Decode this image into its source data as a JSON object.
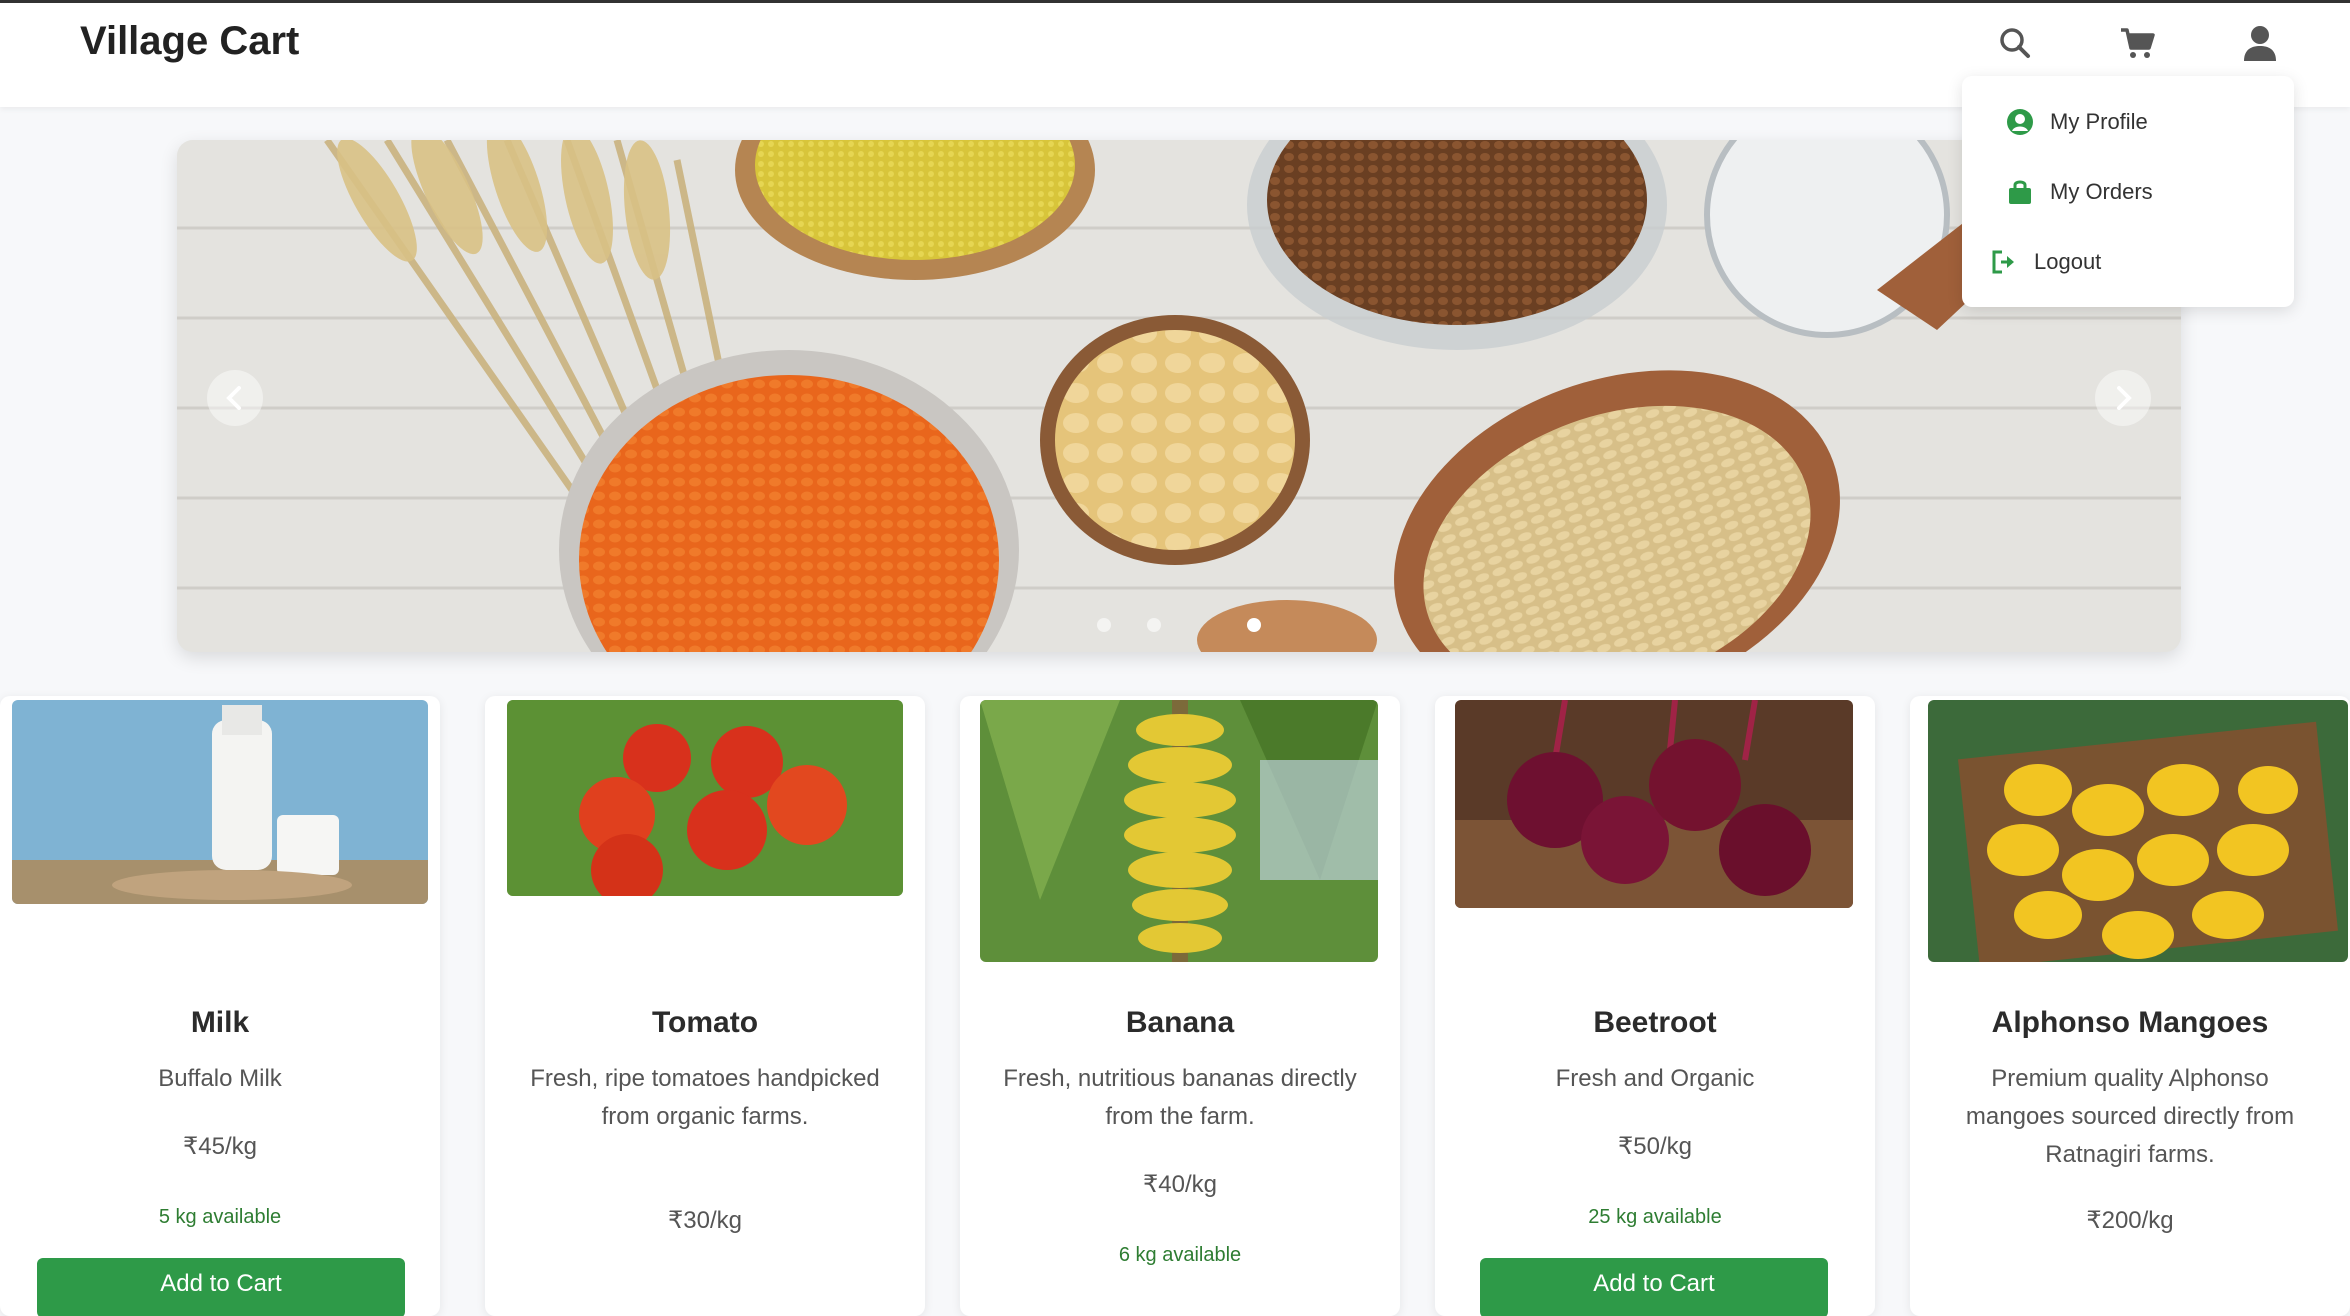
{
  "app": {
    "brand": "Village Cart"
  },
  "nav": {
    "icons": [
      "search-icon",
      "cart-icon",
      "user-icon"
    ]
  },
  "user_menu": {
    "items": [
      {
        "label": "My Profile",
        "icon": "user-circle-icon"
      },
      {
        "label": "My Orders",
        "icon": "shopping-bag-icon"
      },
      {
        "label": "Logout",
        "icon": "logout-icon"
      }
    ]
  },
  "carousel": {
    "slide_count": 3,
    "active_slide": 3,
    "image": "grains-and-pulses-banner"
  },
  "products": [
    {
      "title": "Milk",
      "description": "Buffalo Milk",
      "price": "₹45/kg",
      "availability": "5 kg available",
      "button": "Add to Cart"
    },
    {
      "title": "Tomato",
      "description": "Fresh, ripe tomatoes handpicked from organic farms.",
      "price": "₹30/kg",
      "availability": "",
      "button": ""
    },
    {
      "title": "Banana",
      "description": "Fresh, nutritious bananas directly from the farm.",
      "price": "₹40/kg",
      "availability": "6 kg available",
      "button": ""
    },
    {
      "title": "Beetroot",
      "description": "Fresh and Organic",
      "price": "₹50/kg",
      "availability": "25 kg available",
      "button": "Add to Cart"
    },
    {
      "title": "Alphonso Mangoes",
      "description": "Premium quality Alphonso mangoes sourced directly from Ratnagiri farms.",
      "price": "₹200/kg",
      "availability": "",
      "button": ""
    }
  ],
  "colors": {
    "accent": "#2e9a48",
    "available_text": "#2e7d32"
  }
}
